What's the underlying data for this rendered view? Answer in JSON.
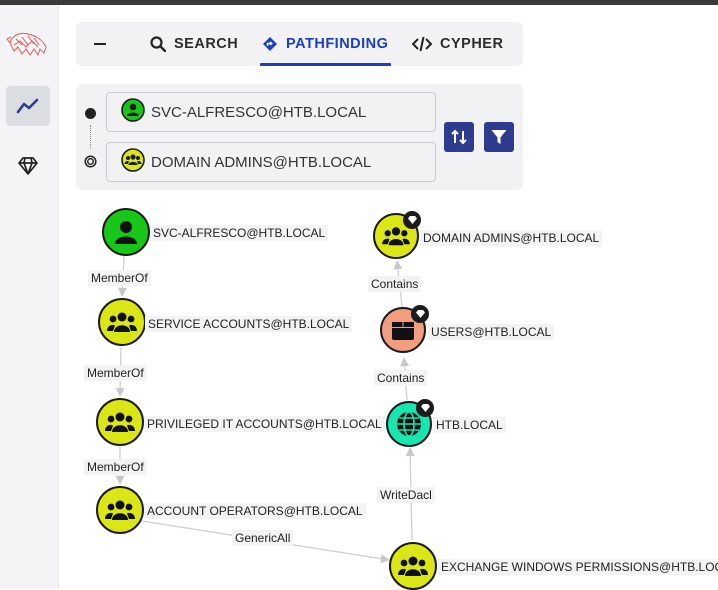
{
  "tabs": [
    {
      "label": ""
    },
    {
      "label": "SEARCH"
    },
    {
      "label": "PATHFINDING"
    },
    {
      "label": "CYPHER"
    }
  ],
  "search": {
    "start_node": "SVC-ALFRESCO@HTB.LOCAL",
    "target_node": "DOMAIN ADMINS@HTB.LOCAL"
  },
  "graph": {
    "nodes": [
      {
        "label": "SVC-ALFRESCO@HTB.LOCAL",
        "type": "user"
      },
      {
        "label": "SERVICE ACCOUNTS@HTB.LOCAL",
        "type": "group"
      },
      {
        "label": "PRIVILEGED IT ACCOUNTS@HTB.LOCAL",
        "type": "group"
      },
      {
        "label": "ACCOUNT OPERATORS@HTB.LOCAL",
        "type": "group"
      },
      {
        "label": "EXCHANGE WINDOWS PERMISSIONS@HTB.LOCAL",
        "type": "group"
      },
      {
        "label": "HTB.LOCAL",
        "type": "domain"
      },
      {
        "label": "USERS@HTB.LOCAL",
        "type": "container"
      },
      {
        "label": "DOMAIN ADMINS@HTB.LOCAL",
        "type": "group"
      }
    ],
    "edges": [
      {
        "label": "MemberOf"
      },
      {
        "label": "MemberOf"
      },
      {
        "label": "MemberOf"
      },
      {
        "label": "GenericAll"
      },
      {
        "label": "WriteDacl"
      },
      {
        "label": "Contains"
      },
      {
        "label": "Contains"
      }
    ]
  },
  "colors": {
    "accent": "#1a3fbf",
    "button": "#2f3b8f",
    "user_node": "#17c717",
    "group_node": "#dbe617",
    "domain_node": "#17e6b0",
    "container_node": "#f29c80"
  }
}
